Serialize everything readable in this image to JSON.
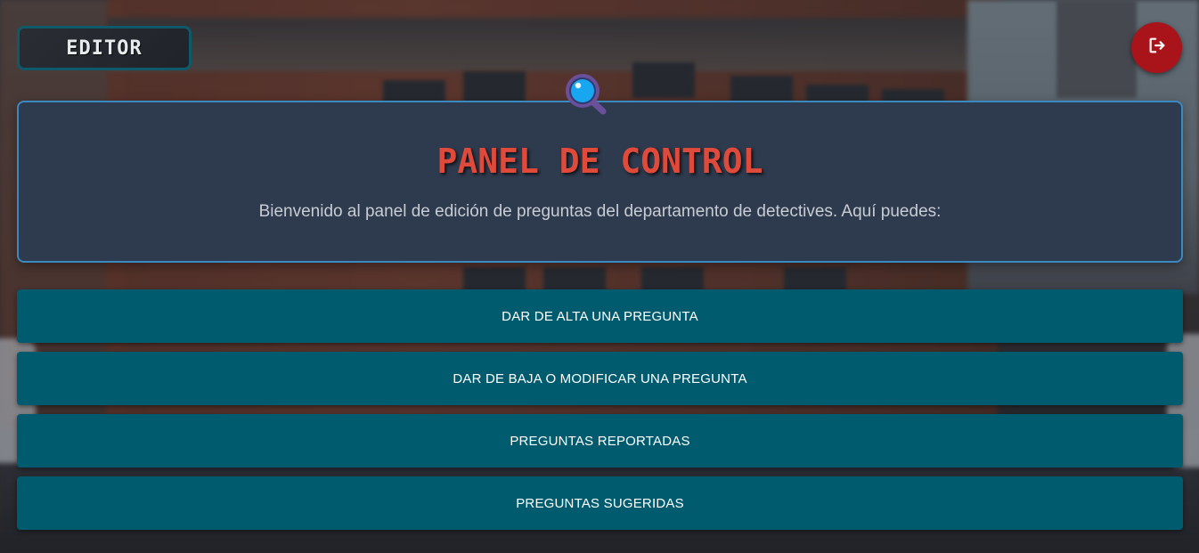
{
  "header": {
    "role_label": "EDITOR",
    "logout_icon": "logout-icon"
  },
  "panel": {
    "title": "PANEL DE CONTROL",
    "subtitle": "Bienvenido al panel de edición de preguntas del departamento de detectives. Aquí puedes:",
    "icon": "magnifier-icon"
  },
  "actions": [
    {
      "label": "DAR DE ALTA UNA PREGUNTA"
    },
    {
      "label": "DAR DE BAJA O MODIFICAR UNA PREGUNTA"
    },
    {
      "label": "PREGUNTAS REPORTADAS"
    },
    {
      "label": "PREGUNTAS SUGERIDAS"
    }
  ],
  "colors": {
    "accent": "#005b6e",
    "title": "#e04a3b",
    "panel_border": "#3a89c0",
    "logout": "#a8141a"
  }
}
